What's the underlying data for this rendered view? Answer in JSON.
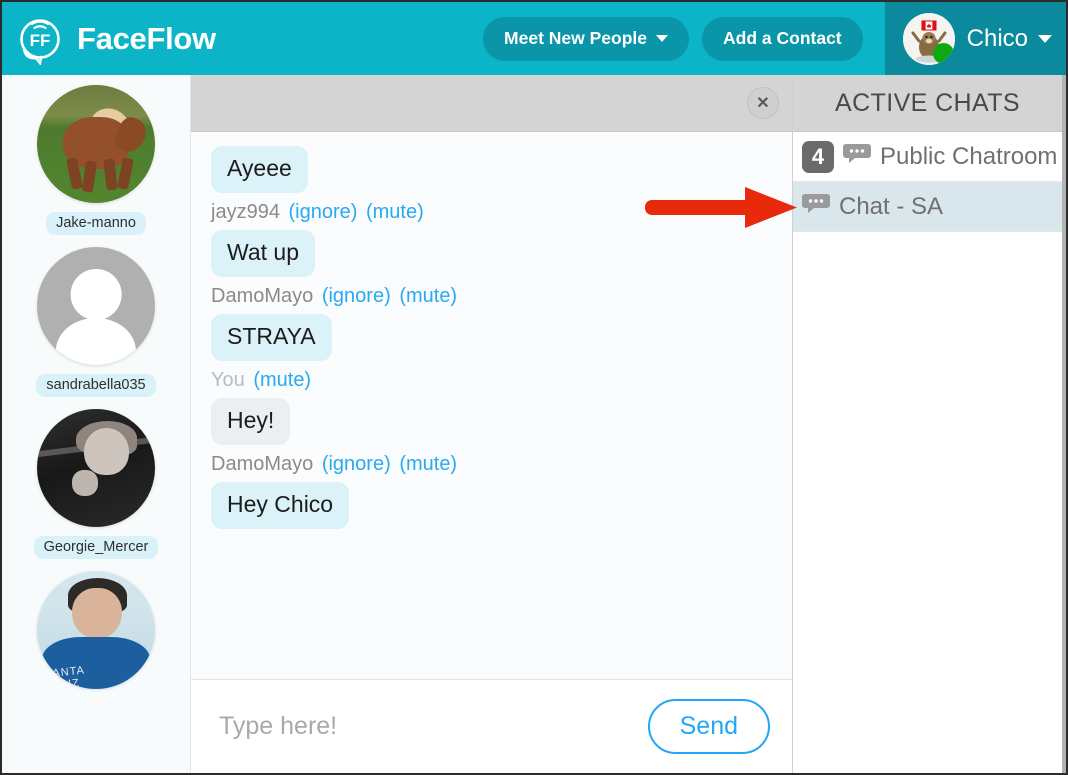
{
  "header": {
    "brand_name": "FaceFlow",
    "logo_icon": "faceflow-logo-icon",
    "meet_new_people_label": "Meet New People",
    "add_contact_label": "Add a Contact",
    "user_name": "Chico",
    "user_avatar_icon": "beaver-canada-avatar",
    "status": "online",
    "brand_color": "#0cb4c8",
    "button_color": "#0a95a8",
    "user_box_color": "#0a8a9c",
    "online_dot_color": "#10a810"
  },
  "contacts": {
    "items": [
      {
        "name": "Jake-manno",
        "avatar": "horse-photo-avatar"
      },
      {
        "name": "sandrabella035",
        "avatar": "default-person-avatar"
      },
      {
        "name": "Georgie_Mercer",
        "avatar": "blackwhite-girl-photo-avatar"
      },
      {
        "name": "",
        "avatar": "boy-hoodie-photo-avatar"
      }
    ]
  },
  "chat": {
    "close_icon": "close-x-icon",
    "messages": [
      {
        "author": "",
        "actions": [],
        "text": "Ayeee",
        "self": false,
        "show_meta": false
      },
      {
        "author": "jayz994",
        "actions": [
          "(ignore)",
          "(mute)"
        ],
        "text": "Wat up",
        "self": false,
        "show_meta": true
      },
      {
        "author": "DamoMayo",
        "actions": [
          "(ignore)",
          "(mute)"
        ],
        "text": "STRAYA",
        "self": false,
        "show_meta": true
      },
      {
        "author": "You",
        "actions": [
          "(mute)"
        ],
        "text": "Hey!",
        "self": true,
        "show_meta": true
      },
      {
        "author": "DamoMayo",
        "actions": [
          "(ignore)",
          "(mute)"
        ],
        "text": "Hey Chico",
        "self": false,
        "show_meta": true
      }
    ],
    "composer": {
      "value": "",
      "placeholder": "Type here!",
      "send_label": "Send"
    },
    "bubble_color": "#dbf2f8",
    "self_bubble_color": "#eceff1",
    "action_link_color": "#29a9f2"
  },
  "active_chats": {
    "title": "ACTIVE CHATS",
    "items": [
      {
        "badge": "4",
        "icon": "chat-bubble-icon",
        "label": "Public Chatroom",
        "active": false
      },
      {
        "badge": "",
        "icon": "chat-bubble-icon",
        "label": "Chat - SA",
        "active": true
      }
    ]
  },
  "annotation": {
    "arrow": "red-arrow-pointing-right",
    "color": "#e8290b"
  }
}
